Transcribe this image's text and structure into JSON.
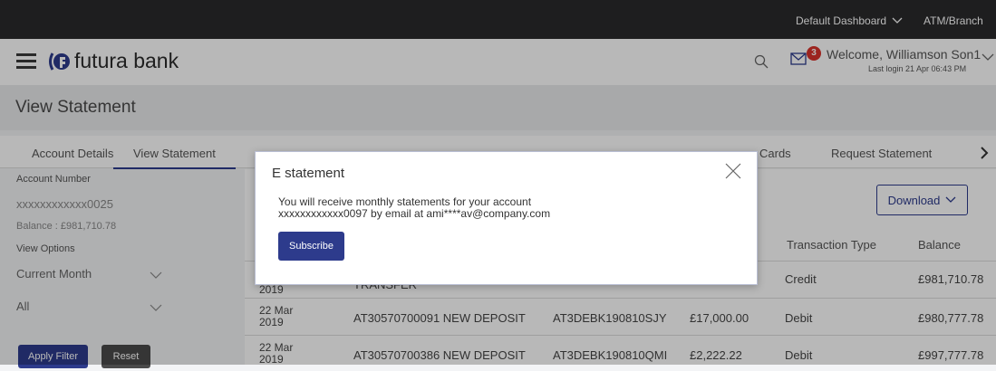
{
  "topbar": {
    "dashboard_label": "Default Dashboard",
    "atm_label": "ATM/Branch"
  },
  "header": {
    "logo_text": "futura bank",
    "mail_badge_count": "3",
    "welcome_text": "Welcome, Williamson Son1",
    "last_login": "Last login 21 Apr 06:43 PM"
  },
  "page": {
    "title": "View Statement"
  },
  "tabs": {
    "account_details": "Account Details",
    "view_statement": "View Statement",
    "cards": "Cards",
    "request_statement": "Request Statement"
  },
  "left": {
    "account_number_label": "Account Number",
    "account_number_value": "xxxxxxxxxxxx0025",
    "balance_text": "Balance : £981,710.78",
    "view_options_label": "View Options",
    "period_value": "Current Month",
    "type_value": "All",
    "apply_label": "Apply Filter",
    "reset_label": "Reset"
  },
  "main": {
    "download_label": "Download",
    "headers": {
      "transaction_type": "Transaction Type",
      "balance": "Balance"
    },
    "rows": [
      {
        "date_line1": "",
        "date_line2": "2019",
        "desc": "TRANSFER",
        "ref": "",
        "amount": "",
        "type": "Credit",
        "balance": "£981,710.78"
      },
      {
        "date_line1": "22 Mar",
        "date_line2": "2019",
        "desc": "AT30570700091 NEW DEPOSIT",
        "ref": "AT3DEBK190810SJY",
        "amount": "£17,000.00",
        "type": "Debit",
        "balance": "£980,777.78"
      },
      {
        "date_line1": "22 Mar",
        "date_line2": "2019",
        "desc": "AT30570700386 NEW DEPOSIT",
        "ref": "AT3DEBK190810QMI",
        "amount": "£2,222.22",
        "type": "Debit",
        "balance": "£997,777.78"
      }
    ]
  },
  "modal": {
    "title": "E statement",
    "line1": "You will receive monthly statements for your account",
    "line2": "xxxxxxxxxxxx0097 by email at ami****av@company.com",
    "subscribe_label": "Subscribe"
  },
  "colors": {
    "primary": "#2d3b8c",
    "topbar": "#2a2a2c",
    "badge": "#d9322b",
    "logo_accent": "#2d3b8c"
  },
  "icons": [
    "hamburger-icon",
    "logo-icon",
    "search-icon",
    "mail-icon",
    "chevron-down-icon",
    "chevron-right-icon",
    "close-icon"
  ]
}
